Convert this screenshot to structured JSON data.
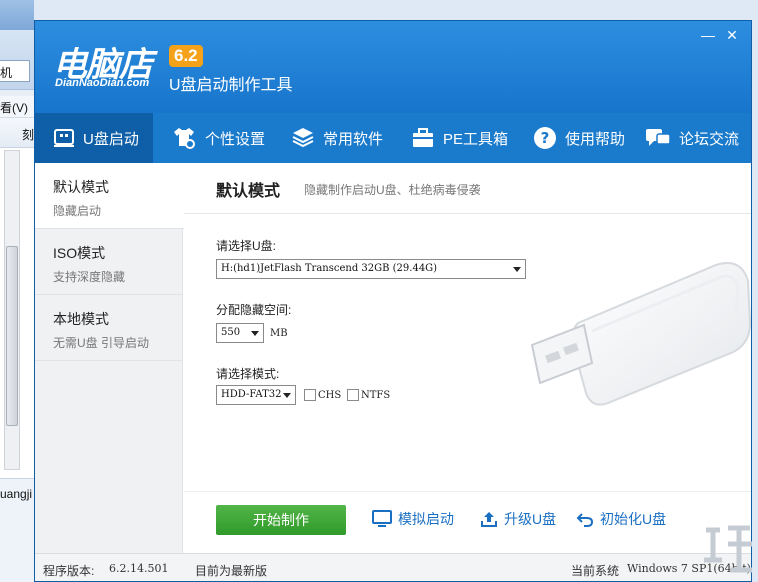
{
  "background_window": {
    "address_text": "机",
    "menu_text": "看(V)",
    "toolbar_text": "刻",
    "lower_text": "uangji"
  },
  "app": {
    "logo_cn": "电脑店",
    "logo_version": "6.2",
    "logo_en": "DianNaoDian.com",
    "logo_subtitle": "U盘启动制作工具",
    "window_controls": {
      "minimize": "—",
      "close": "✕"
    }
  },
  "nav": [
    {
      "label": "U盘启动",
      "icon": "usb-drive-icon"
    },
    {
      "label": "个性设置",
      "icon": "shirt-gear-icon"
    },
    {
      "label": "常用软件",
      "icon": "layers-icon"
    },
    {
      "label": "PE工具箱",
      "icon": "toolbox-icon"
    },
    {
      "label": "使用帮助",
      "icon": "help-icon"
    },
    {
      "label": "论坛交流",
      "icon": "chat-icon"
    }
  ],
  "sidebar": [
    {
      "title": "默认模式",
      "subtitle": "隐藏启动"
    },
    {
      "title": "ISO模式",
      "subtitle": "支持深度隐藏"
    },
    {
      "title": "本地模式",
      "subtitle": "无需U盘 引导启动"
    }
  ],
  "main": {
    "title": "默认模式",
    "subtitle": "隐藏制作启动U盘、杜绝病毒侵袭",
    "select_disk_label": "请选择U盘:",
    "disk_value": "H:(hd1)JetFlash Transcend 32GB (29.44G)",
    "hidden_space_label": "分配隐藏空间:",
    "hidden_space_value": "550",
    "hidden_space_unit": "MB",
    "mode_label": "请选择模式:",
    "mode_value": "HDD-FAT32",
    "chs_label": "CHS",
    "ntfs_label": "NTFS",
    "chs_checked": false,
    "ntfs_checked": false
  },
  "actions": {
    "start": "开始制作",
    "simulate": "模拟启动",
    "upgrade": "升级U盘",
    "init": "初始化U盘"
  },
  "status": {
    "version_label": "程序版本:",
    "version_value": "6.2.14.501",
    "latest_text": "目前为最新版",
    "system_label": "当前系统",
    "system_value": "Windows 7 SP1(64bit)"
  },
  "colors": {
    "titlebar": "#1d7ed0",
    "nav_active": "#0f5fa8",
    "start_button": "#3ea636",
    "link": "#1a6fc2",
    "version_badge": "#f4a21a"
  }
}
